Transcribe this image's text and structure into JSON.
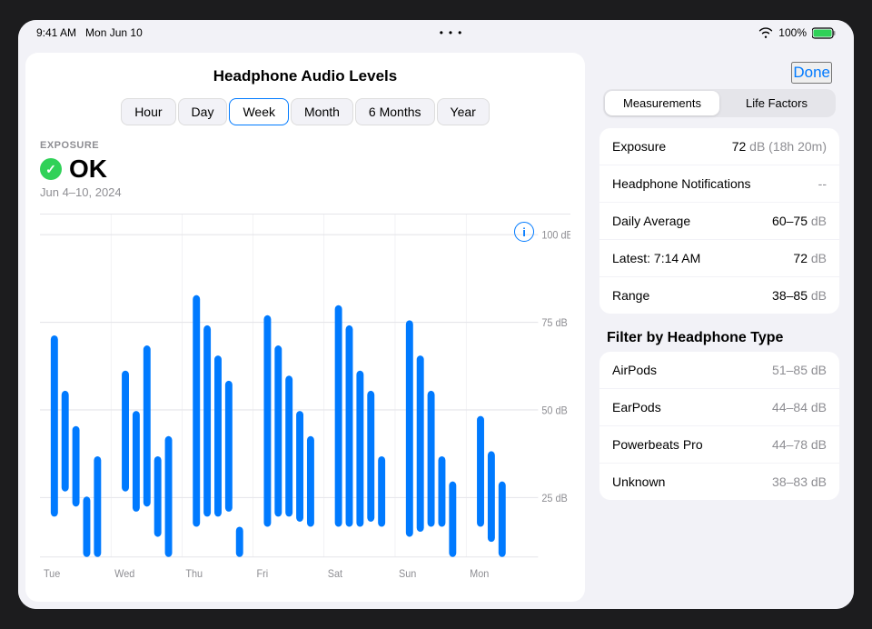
{
  "statusBar": {
    "time": "9:41 AM",
    "date": "Mon Jun 10",
    "wifi": true,
    "battery": "100%"
  },
  "pageTitle": "Headphone Audio Levels",
  "timeTabs": [
    {
      "label": "Hour",
      "active": false
    },
    {
      "label": "Day",
      "active": false
    },
    {
      "label": "Week",
      "active": true
    },
    {
      "label": "Month",
      "active": false
    },
    {
      "label": "6 Months",
      "active": false
    },
    {
      "label": "Year",
      "active": false
    }
  ],
  "exposure": {
    "sectionLabel": "EXPOSURE",
    "status": "OK",
    "dateRange": "Jun 4–10, 2024"
  },
  "chartGrid": {
    "labels": [
      "100 dB",
      "75 dB",
      "50 dB",
      "25 dB"
    ],
    "dayLabels": [
      "Tue",
      "Wed",
      "Thu",
      "Fri",
      "Sat",
      "Sun",
      "Mon"
    ]
  },
  "rightPanel": {
    "doneLabel": "Done",
    "tabs": [
      {
        "label": "Measurements",
        "active": true
      },
      {
        "label": "Life Factors",
        "active": false
      }
    ],
    "metrics": [
      {
        "name": "Exposure",
        "value": "72 dB (18h 20m)"
      },
      {
        "name": "Headphone Notifications",
        "value": "--"
      },
      {
        "name": "Daily Average",
        "value": "60–75 dB"
      },
      {
        "name": "Latest: 7:14 AM",
        "value": "72 dB"
      },
      {
        "name": "Range",
        "value": "38–85 dB"
      }
    ],
    "filterSectionLabel": "Filter by Headphone Type",
    "filterItems": [
      {
        "name": "AirPods",
        "value": "51–85 dB"
      },
      {
        "name": "EarPods",
        "value": "44–84 dB"
      },
      {
        "name": "Powerbeats Pro",
        "value": "44–78 dB"
      },
      {
        "name": "Unknown",
        "value": "38–83 dB"
      }
    ]
  }
}
